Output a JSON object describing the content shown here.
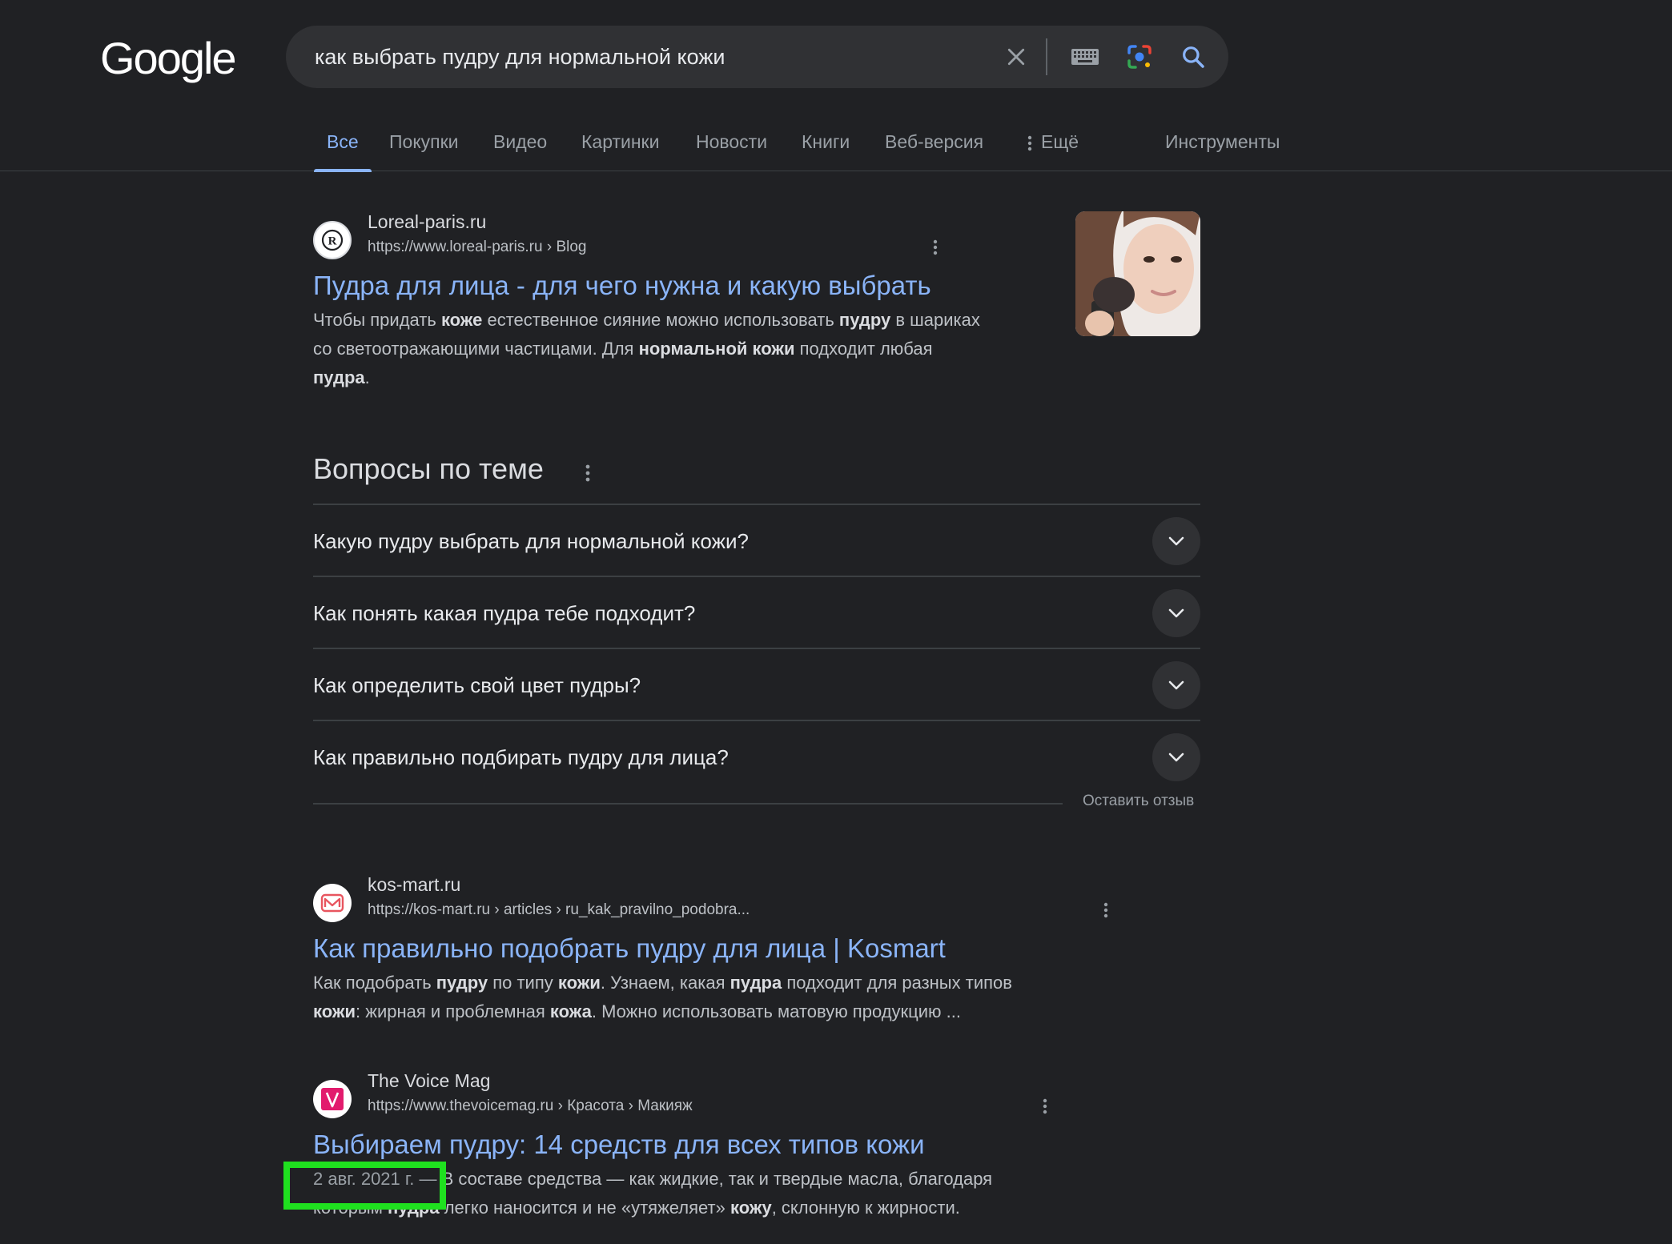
{
  "header": {
    "logo_text": "Google",
    "search": {
      "value": "как выбрать пудру для нормальной кожи",
      "icons": [
        "close-icon",
        "keyboard-icon",
        "google-lens-icon",
        "search-icon"
      ]
    }
  },
  "tabs": [
    {
      "label": "Все",
      "active": true
    },
    {
      "label": "Покупки"
    },
    {
      "label": "Видео"
    },
    {
      "label": "Картинки"
    },
    {
      "label": "Новости"
    },
    {
      "label": "Книги"
    },
    {
      "label": "Веб-версия"
    },
    {
      "label": "Ещё"
    },
    {
      "label": "Инструменты"
    }
  ],
  "results": [
    {
      "site_name": "Loreal-paris.ru",
      "url": "https://www.loreal-paris.ru › Blog",
      "title": "Пудра для лица - для чего нужна и какую выбрать",
      "snippet": [
        [
          "Чтобы придать ",
          false
        ],
        [
          "коже",
          true
        ],
        [
          " естественное сияние можно использовать ",
          false
        ],
        [
          "пудру",
          true
        ],
        [
          " в шариках",
          false
        ],
        [
          "\n",
          false
        ],
        [
          "со светоотражающими частицами. Для ",
          false
        ],
        [
          "нормальной кожи",
          true
        ],
        [
          " подходит любая",
          false
        ],
        [
          "\n",
          false
        ],
        [
          "пудра",
          true
        ],
        [
          ".",
          false
        ]
      ]
    },
    {
      "site_name": "kos-mart.ru",
      "url": "https://kos-mart.ru › articles › ru_kak_pravilno_podobra...",
      "title": "Как правильно подобрать пудру для лица | Kosmart",
      "snippet": [
        [
          "Как подобрать ",
          false
        ],
        [
          "пудру",
          true
        ],
        [
          " по типу ",
          false
        ],
        [
          "кожи",
          true
        ],
        [
          ". Узнаем, какая ",
          false
        ],
        [
          "пудра",
          true
        ],
        [
          " подходит для разных типов",
          false
        ],
        [
          "\n",
          false
        ],
        [
          "кожи",
          true
        ],
        [
          ": жирная и проблемная ",
          false
        ],
        [
          "кожа",
          true
        ],
        [
          ". Можно использовать матовую продукцию ...",
          false
        ]
      ]
    },
    {
      "site_name": "The Voice Mag",
      "url": "https://www.thevoicemag.ru › Красота › Макияж",
      "title": "Выбираем пудру: 14 средств для всех типов кожи",
      "date": "2 авг. 2021 г. — ",
      "snippet": [
        [
          "В составе средства — как жидкие, так и твердые масла, благодаря",
          false
        ],
        [
          "\n",
          false
        ],
        [
          "которым ",
          false
        ],
        [
          "пудра",
          true
        ],
        [
          " легко наносится и не «утяжеляет» ",
          false
        ],
        [
          "кожу",
          true
        ],
        [
          ", склонную к жирности.",
          false
        ]
      ]
    }
  ],
  "paa": {
    "heading": "Вопросы по теме",
    "questions": [
      "Какую пудру выбрать для нормальной кожи?",
      "Как понять какая пудра тебе подходит?",
      "Как определить свой цвет пудры?",
      "Как правильно подбирать пудру для лица?"
    ],
    "feedback": "Оставить отзыв"
  },
  "colors": {
    "background": "#202124",
    "link": "#8ab4f8",
    "highlight": "#1fe01f"
  }
}
